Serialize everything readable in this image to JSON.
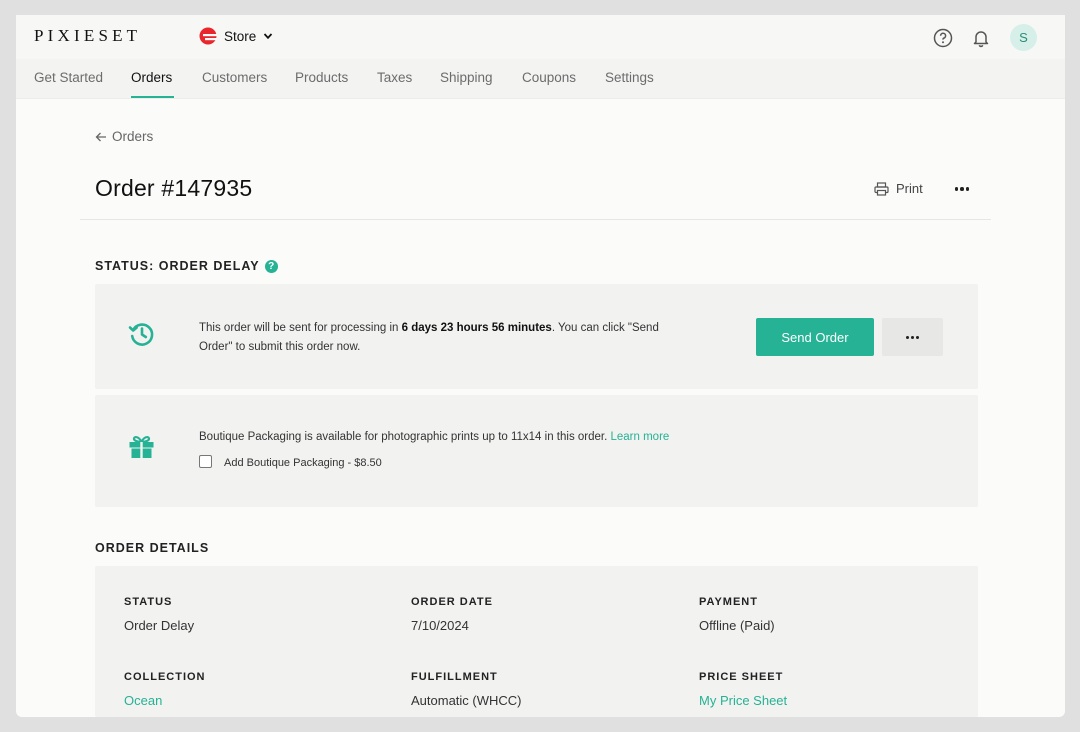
{
  "topbar": {
    "logo": "PIXIESET",
    "store_label": "Store",
    "avatar_initial": "S",
    "brand_color": "#e8262b"
  },
  "nav": {
    "tabs": [
      "Get Started",
      "Orders",
      "Customers",
      "Products",
      "Taxes",
      "Shipping",
      "Coupons",
      "Settings"
    ],
    "active": "Orders"
  },
  "page": {
    "back_label": "Orders",
    "title": "Order #147935",
    "print_label": "Print"
  },
  "status_section": {
    "title": "STATUS: ORDER DELAY",
    "help_icon": "?",
    "message_before": "This order will be sent for processing in ",
    "message_bold": "6 days 23 hours 56 minutes",
    "message_after": ". You can click \"Send Order\" to submit this order now.",
    "send_button": "Send Order",
    "packaging_text": "Boutique Packaging is available for photographic prints up to 11x14 in this order. ",
    "learn_more": "Learn more",
    "packaging_checkbox_label": "Add Boutique Packaging - $8.50",
    "packaging_checked": false
  },
  "details_section": {
    "title": "ORDER DETAILS",
    "status_label": "STATUS",
    "status_value": "Order Delay",
    "date_label": "ORDER DATE",
    "date_value": "7/10/2024",
    "payment_label": "PAYMENT",
    "payment_value": "Offline (Paid)",
    "collection_label": "COLLECTION",
    "collection_value": "Ocean",
    "fulfillment_label": "FULFILLMENT",
    "fulfillment_value": "Automatic (WHCC)",
    "pricesheet_label": "PRICE SHEET",
    "pricesheet_value": "My Price Sheet"
  },
  "colors": {
    "accent": "#26b294",
    "panel_bg": "#f2f2f1"
  }
}
